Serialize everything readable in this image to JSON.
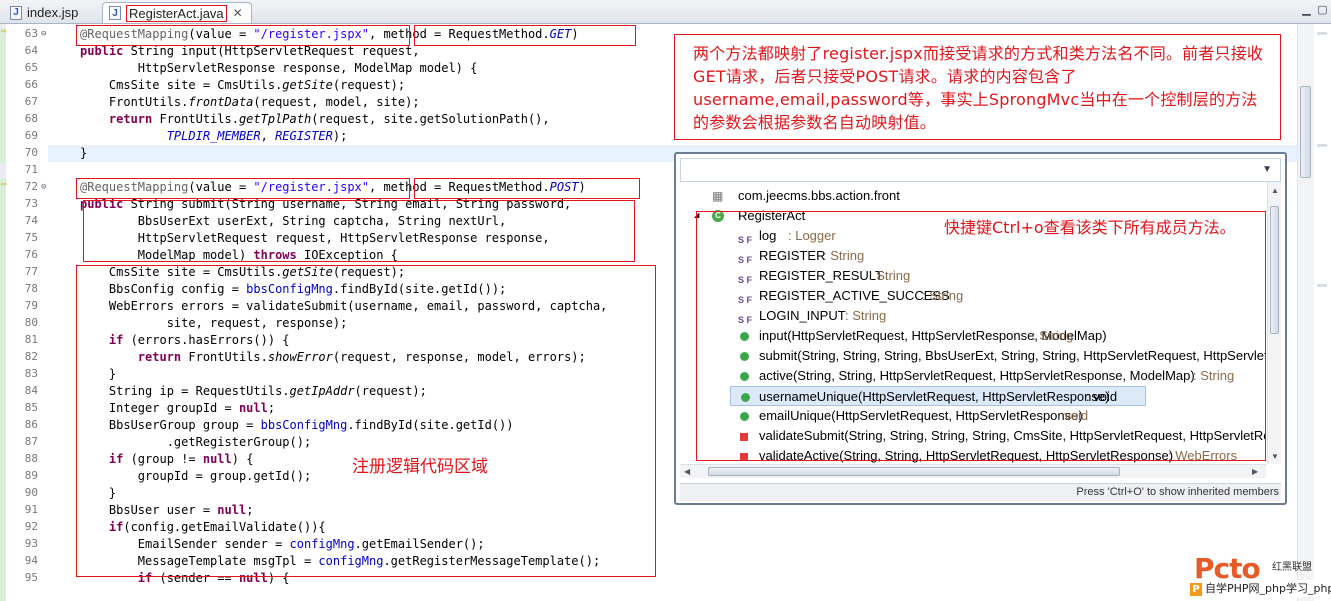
{
  "tabs": [
    {
      "label": "index.jsp",
      "icon": "jsp-file-icon"
    },
    {
      "label": "RegisterAct.java",
      "icon": "java-file-icon"
    }
  ],
  "line_numbers": [
    "63",
    "64",
    "65",
    "66",
    "67",
    "68",
    "69",
    "70",
    "71",
    "72",
    "73",
    "74",
    "75",
    "76",
    "77",
    "78",
    "79",
    "80",
    "81",
    "82",
    "83",
    "84",
    "85",
    "86",
    "87",
    "88",
    "89",
    "90",
    "91",
    "92",
    "93",
    "94",
    "95"
  ],
  "code": {
    "l63_a": "@RequestMapping",
    "l63_b": "(value = ",
    "l63_c": "\"/register.jspx\"",
    "l63_d": ", ",
    "l63_e": "method = RequestMethod.",
    "l63_f": "GET",
    "l63_g": ")",
    "l64_a": "public",
    "l64_b": " String input(HttpServletRequest request,",
    "l65": "        HttpServletResponse response, ModelMap model) {",
    "l66_a": "    CmsSite site = CmsUtils.",
    "l66_b": "getSite",
    "l66_c": "(request);",
    "l67_a": "    FrontUtils.",
    "l67_b": "frontData",
    "l67_c": "(request, model, site);",
    "l68_a": "    return",
    "l68_b": " FrontUtils.",
    "l68_c": "getTplPath",
    "l68_d": "(request, site.getSolutionPath(),",
    "l69_a": "            TPLDIR_MEMBER",
    "l69_b": ", ",
    "l69_c": "REGISTER",
    "l69_d": ");",
    "l70": "}",
    "l72_a": "@RequestMapping",
    "l72_b": "(value = ",
    "l72_c": "\"/register.jspx\"",
    "l72_d": ", ",
    "l72_e": "method = RequestMethod.",
    "l72_f": "POST",
    "l72_g": ")",
    "l73_a": "public",
    "l73_b": " String submit(String username, String email, String password,",
    "l74": "        BbsUserExt userExt, String captcha, String nextUrl,",
    "l75": "        HttpServletRequest request, HttpServletResponse response,",
    "l76_a": "        ModelMap model) ",
    "l76_b": "throws",
    "l76_c": " IOException {",
    "l77_a": "    CmsSite site = CmsUtils.",
    "l77_b": "getSite",
    "l77_c": "(request);",
    "l78_a": "    BbsConfig config = ",
    "l78_b": "bbsConfigMng",
    "l78_c": ".findById(site.getId());",
    "l79": "    WebErrors errors = validateSubmit(username, email, password, captcha,",
    "l80": "            site, request, response);",
    "l81_a": "    if",
    "l81_b": " (errors.hasErrors()) {",
    "l82_a": "        return",
    "l82_b": " FrontUtils.",
    "l82_c": "showError",
    "l82_d": "(request, response, model, errors);",
    "l83": "    }",
    "l84_a": "    String ip = RequestUtils.",
    "l84_b": "getIpAddr",
    "l84_c": "(request);",
    "l85_a": "    Integer groupId = ",
    "l85_b": "null",
    "l85_c": ";",
    "l86_a": "    BbsUserGroup group = ",
    "l86_b": "bbsConfigMng",
    "l86_c": ".findById(site.getId())",
    "l87": "            .getRegisterGroup();",
    "l88_a": "    if",
    "l88_b": " (group != ",
    "l88_c": "null",
    "l88_d": ") {",
    "l89": "        groupId = group.getId();",
    "l90": "    }",
    "l91_a": "    BbsUser user = ",
    "l91_b": "null",
    "l91_c": ";",
    "l92_a": "    if",
    "l92_b": "(config.getEmailValidate()){",
    "l93_a": "        EmailSender sender = ",
    "l93_b": "configMng",
    "l93_c": ".getEmailSender();",
    "l94_a": "        MessageTemplate msgTpl = ",
    "l94_b": "configMng",
    "l94_c": ".getRegisterMessageTemplate();",
    "l95_a": "        if",
    "l95_b": " (sender == ",
    "l95_c": "null",
    "l95_d": ") {"
  },
  "annotations": {
    "note_top": "两个方法都映射了register.jspx而接受请求的方式和类方法名不同。前者只接收GET请求，后者只接受POST请求。请求的内容包含了username,email,password等，事实上SprongMvc当中在一个控制层的方法的参数会根据参数名自动映射值。",
    "note_register": "注册逻辑代码区域",
    "note_popup": "快捷键Ctrl+o查看该类下所有成员方法。"
  },
  "outline": {
    "package": "com.jeecms.bbs.action.front",
    "class": "RegisterAct",
    "members": [
      {
        "name": "log",
        "type": " : Logger",
        "kind": "static-final-field"
      },
      {
        "name": "REGISTER",
        "type": " : String",
        "kind": "static-final-field"
      },
      {
        "name": "REGISTER_RESULT",
        "type": " : String",
        "kind": "static-final-field"
      },
      {
        "name": "REGISTER_ACTIVE_SUCCESS",
        "type": " : String",
        "kind": "static-final-field"
      },
      {
        "name": "LOGIN_INPUT",
        "type": " : String",
        "kind": "static-final-field"
      },
      {
        "name": "input(HttpServletRequest, HttpServletResponse, ModelMap)",
        "type": " : String",
        "kind": "public-method"
      },
      {
        "name": "submit(String, String, String, BbsUserExt, String, String, HttpServletRequest, HttpServlet",
        "type": "",
        "kind": "public-method"
      },
      {
        "name": "active(String, String, HttpServletRequest, HttpServletResponse, ModelMap)",
        "type": " : String",
        "kind": "public-method"
      },
      {
        "name": "usernameUnique(HttpServletRequest, HttpServletResponse)",
        "type": " : void",
        "kind": "public-method"
      },
      {
        "name": "emailUnique(HttpServletRequest, HttpServletResponse)",
        "type": " : void",
        "kind": "public-method"
      },
      {
        "name": "validateSubmit(String, String, String, String, CmsSite, HttpServletRequest, HttpServletRe",
        "type": "",
        "kind": "private-method"
      },
      {
        "name": "validateActive(String, String, HttpServletRequest, HttpServletResponse)",
        "type": " : WebErrors",
        "kind": "private-method"
      }
    ],
    "sf_badge": "S F",
    "status": "Press 'Ctrl+O' to show inherited members"
  },
  "watermark": {
    "logo": "Pcto",
    "tag": "红黑联盟",
    "site": "自学PHP网_php学习_php教"
  }
}
